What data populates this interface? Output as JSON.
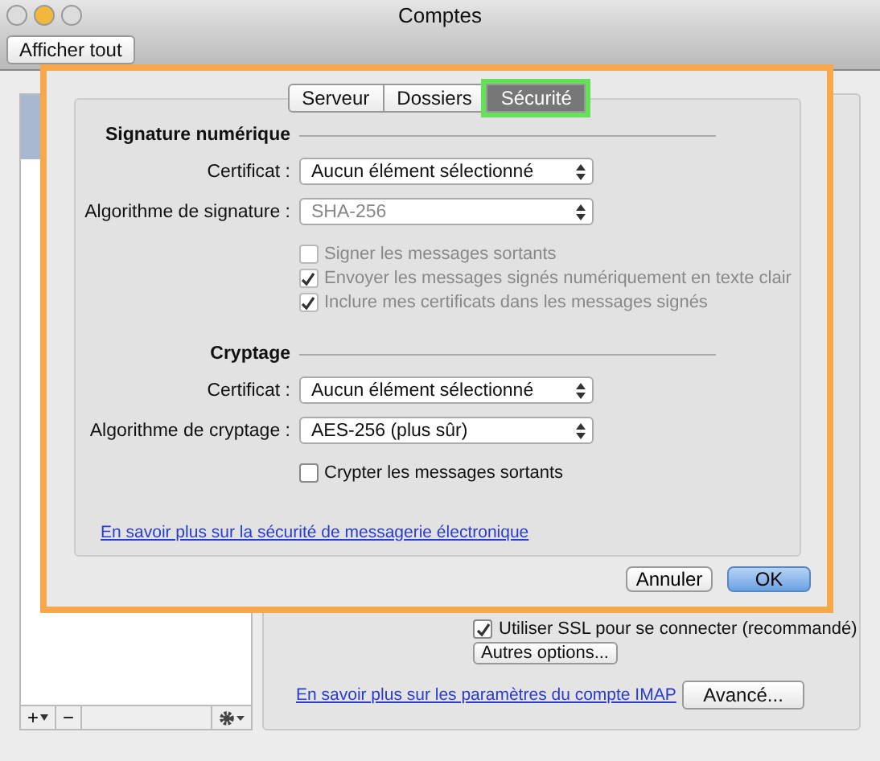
{
  "window": {
    "title": "Comptes"
  },
  "toolbar": {
    "show_all_button": "Afficher tout"
  },
  "sidebar": {
    "accounts": [
      {
        "selected": true
      }
    ],
    "add_button": "+",
    "remove_button": "−"
  },
  "account_panel": {
    "ssl_checkbox": {
      "label": "Utiliser SSL pour se connecter (recommandé)",
      "checked": true
    },
    "more_options_button": "Autres options...",
    "help_link": "En savoir plus sur les paramètres du compte IMAP",
    "advanced_button": "Avancé..."
  },
  "sheet": {
    "tabs": [
      {
        "label": "Serveur",
        "selected": false
      },
      {
        "label": "Dossiers",
        "selected": false
      },
      {
        "label": "Sécurité",
        "selected": true
      }
    ],
    "sections": [
      {
        "title": "Signature numérique",
        "fields": [
          {
            "label": "Certificat :",
            "value": "Aucun élément sélectionné",
            "disabled": false
          },
          {
            "label": "Algorithme de signature :",
            "value": "SHA-256",
            "disabled": true
          }
        ],
        "options": [
          {
            "label": "Signer les messages sortants",
            "checked": false,
            "disabled": true
          },
          {
            "label": "Envoyer les messages signés numériquement en texte clair",
            "checked": true,
            "disabled": true
          },
          {
            "label": "Inclure mes certificats dans les messages signés",
            "checked": true,
            "disabled": true
          }
        ]
      },
      {
        "title": "Cryptage",
        "fields": [
          {
            "label": "Certificat :",
            "value": "Aucun élément sélectionné",
            "disabled": false
          },
          {
            "label": "Algorithme de cryptage :",
            "value": "AES-256 (plus sûr)",
            "disabled": false
          }
        ],
        "options": [
          {
            "label": "Crypter les messages sortants",
            "checked": false,
            "disabled": false
          }
        ]
      }
    ],
    "help_link": "En savoir plus sur la sécurité de messagerie électronique",
    "buttons": [
      {
        "label": "Annuler",
        "default": false
      },
      {
        "label": "OK",
        "default": true
      }
    ]
  }
}
